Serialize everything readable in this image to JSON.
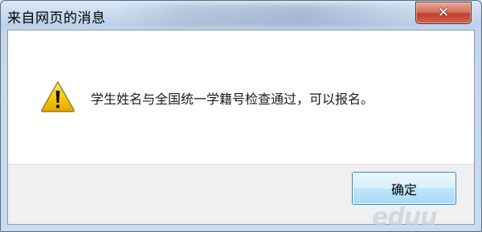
{
  "window": {
    "title": "来自网页的消息",
    "close_glyph": "✕"
  },
  "dialog": {
    "icon": "warning-icon",
    "message": "学生姓名与全国统一学籍号检查通过，可以报名。",
    "ok_label": "确定"
  },
  "watermark": {
    "text": "eduu"
  },
  "colors": {
    "close_button": "#c0412c",
    "ok_button_border": "#3c7fb1",
    "warning_fill": "#f5c400"
  }
}
